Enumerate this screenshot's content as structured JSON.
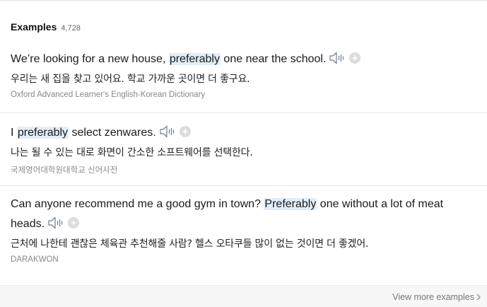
{
  "header": {
    "title": "Examples",
    "count": "4,728"
  },
  "examples": [
    {
      "sentence_before": "We’re looking for a new house, ",
      "highlight": "preferably",
      "sentence_after": " one near the school.",
      "translation": "우리는 새 집을 찾고 있어요. 학교 가까운 곳이면 더 좋구요.",
      "source": "Oxford Advanced Learner's English-Korean Dictionary"
    },
    {
      "sentence_before": "I ",
      "highlight": "preferably",
      "sentence_after": " select zenwares.",
      "translation": "나는 될 수 있는 대로 화면이 간소한 소프트웨어를 선택한다.",
      "source": "국제영어대학원대학교 신어사전"
    },
    {
      "sentence_before": "Can anyone recommend me a good gym in town? ",
      "highlight": "Preferably",
      "sentence_after": " one without a lot of meat",
      "sentence_line2": "heads.",
      "translation": "근처에 나한테 괜찮은 체육관 추천해줄 사람? 헬스 오타쿠들 많이 없는 것이면 더 좋겠어.",
      "source": "DARAKWON"
    }
  ],
  "footer": {
    "view_more_label": "View more examples"
  },
  "colors": {
    "highlight_bg": "#e1eefa",
    "source_text": "#888888",
    "footer_bg": "#f7f7f7"
  },
  "icons": {
    "sound": "speaker-icon",
    "add": "plus-circle-icon",
    "chevron": "chevron-right-icon"
  }
}
